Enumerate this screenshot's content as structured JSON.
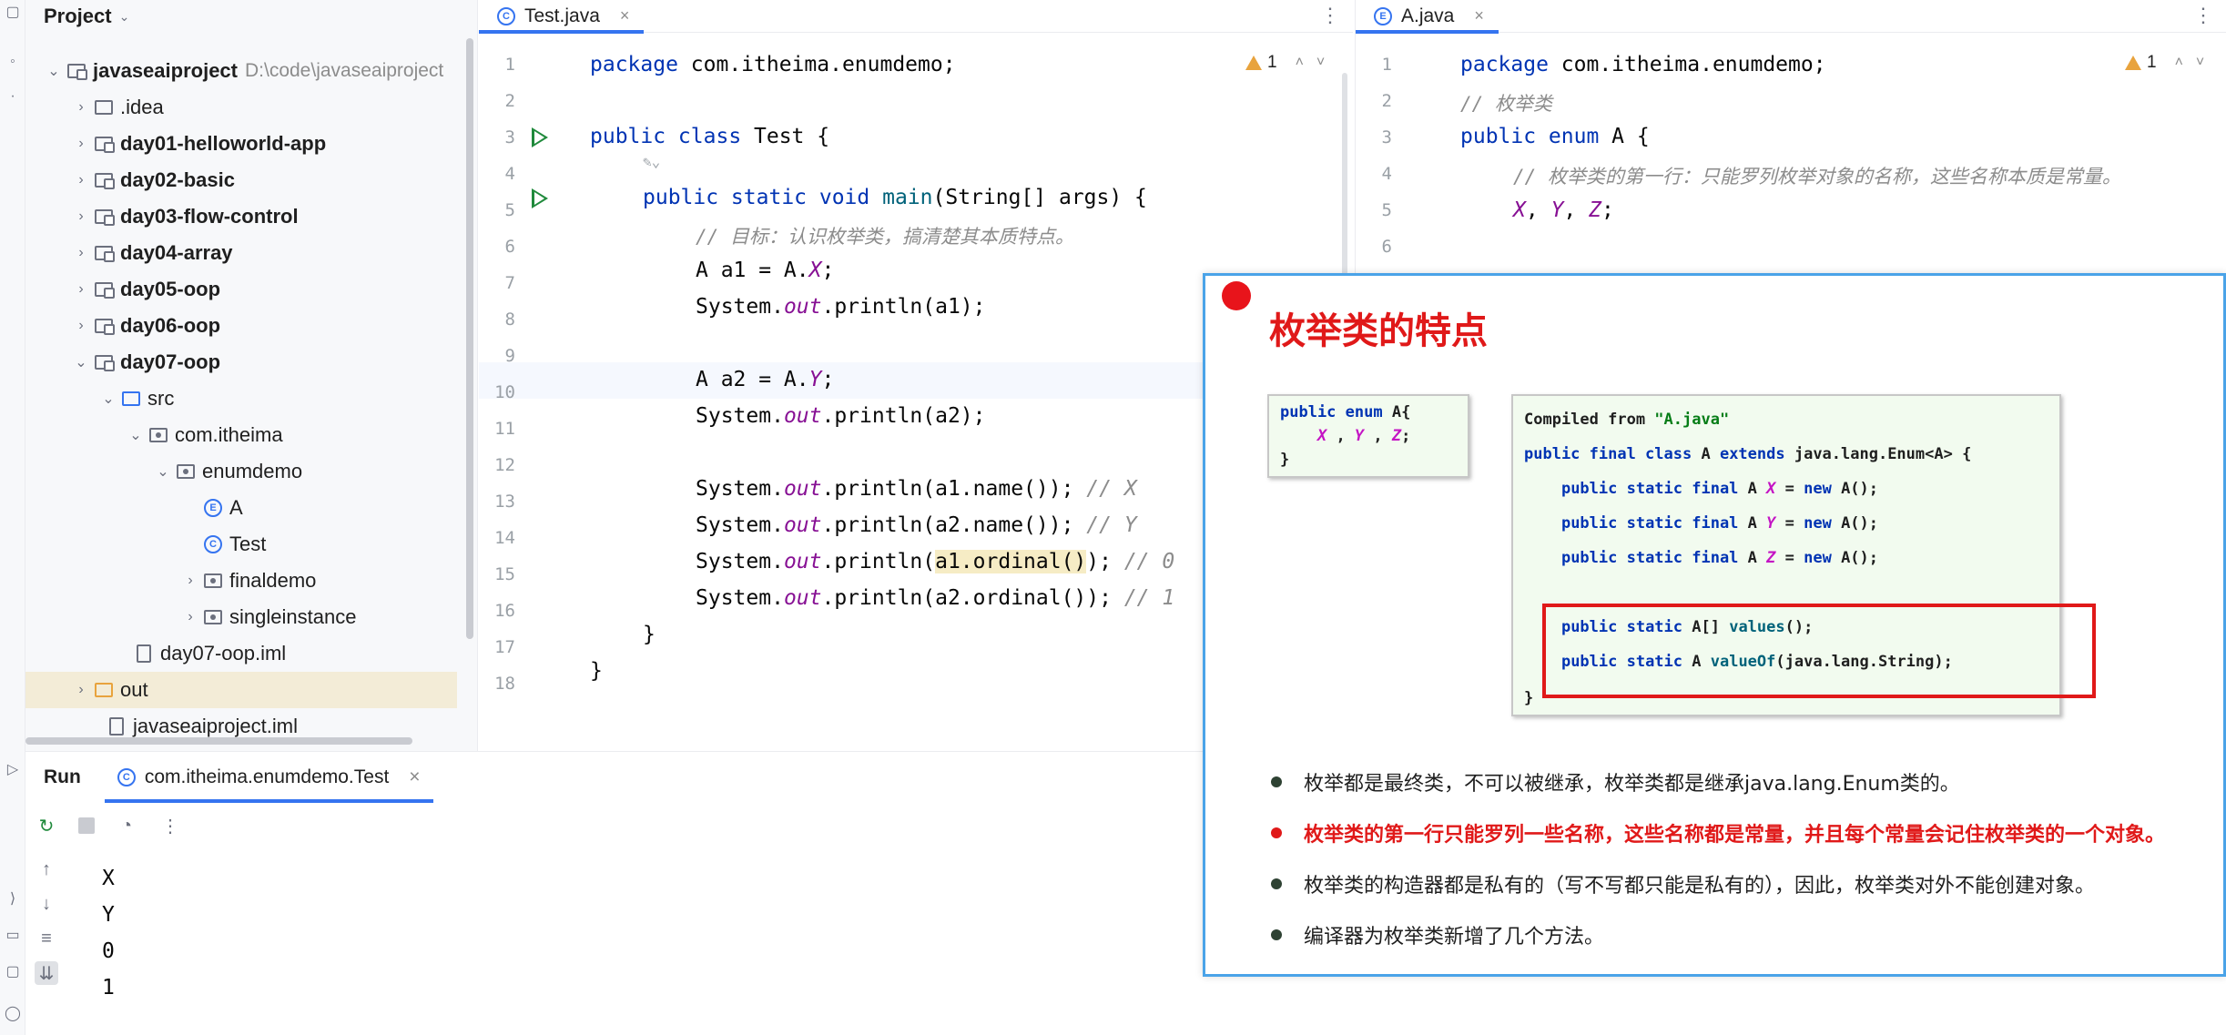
{
  "project_panel": {
    "title": "Project",
    "tree": [
      {
        "label": "javaseaiproject",
        "path": "D:\\code\\javaseaiproject",
        "icon": "module-folder-icon",
        "bold": true
      },
      {
        "label": ".idea",
        "icon": "folder-icon"
      },
      {
        "label": "day01-helloworld-app",
        "icon": "module-folder-icon",
        "bold": true
      },
      {
        "label": "day02-basic",
        "icon": "module-folder-icon",
        "bold": true
      },
      {
        "label": "day03-flow-control",
        "icon": "module-folder-icon",
        "bold": true
      },
      {
        "label": "day04-array",
        "icon": "module-folder-icon",
        "bold": true
      },
      {
        "label": "day05-oop",
        "icon": "module-folder-icon",
        "bold": true
      },
      {
        "label": "day06-oop",
        "icon": "module-folder-icon",
        "bold": true
      },
      {
        "label": "day07-oop",
        "icon": "module-folder-icon",
        "bold": true
      },
      {
        "label": "src",
        "icon": "source-folder-icon"
      },
      {
        "label": "com.itheima",
        "icon": "package-icon"
      },
      {
        "label": "enumdemo",
        "icon": "package-icon"
      },
      {
        "label": "A",
        "icon": "enum-icon"
      },
      {
        "label": "Test",
        "icon": "class-icon"
      },
      {
        "label": "finaldemo",
        "icon": "package-icon"
      },
      {
        "label": "singleinstance",
        "icon": "package-icon"
      },
      {
        "label": "day07-oop.iml",
        "icon": "iml-file-icon"
      },
      {
        "label": "out",
        "icon": "output-folder-icon"
      },
      {
        "label": "javaseaiproject.iml",
        "icon": "iml-file-icon"
      }
    ]
  },
  "editor_left": {
    "tab_label": "Test.java",
    "warning_count": "1",
    "line_numbers": [
      "1",
      "2",
      "3",
      "4",
      "5",
      "6",
      "7",
      "8",
      "9",
      "10",
      "11",
      "12",
      "13",
      "14",
      "15",
      "16",
      "17",
      "18"
    ]
  },
  "editor_right": {
    "tab_label": "A.java",
    "warning_count": "1",
    "line_numbers": [
      "1",
      "2",
      "3",
      "4",
      "5",
      "6"
    ]
  },
  "run_panel": {
    "title": "Run",
    "tab_label": "com.itheima.enumdemo.Test",
    "output": [
      "X",
      "Y",
      "0",
      "1"
    ]
  },
  "slide": {
    "title": "枚举类的特点",
    "bullets": [
      "枚举都是最终类，不可以被继承，枚举类都是继承java.lang.Enum类的。",
      "枚举类的第一行只能罗列一些名称，这些名称都是常量，并且每个常量会记住枚举类的一个对象。",
      "枚举类的构造器都是私有的（写不写都只能是私有的），因此，枚举类对外不能创建对象。",
      "编译器为枚举类新增了几个方法。"
    ]
  }
}
